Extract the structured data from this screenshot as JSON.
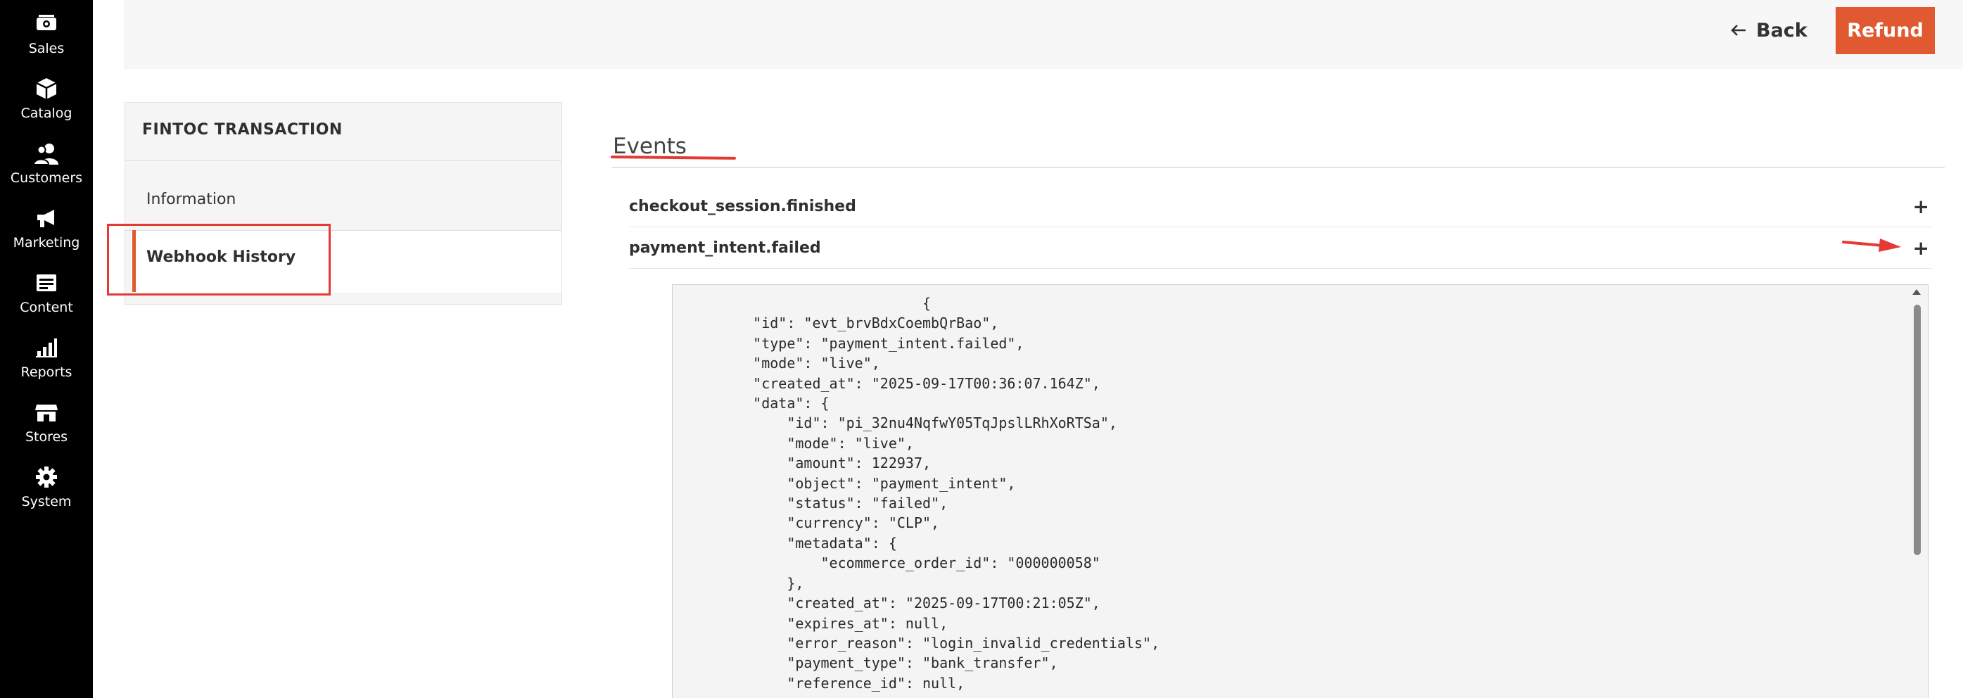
{
  "nav": {
    "items": [
      {
        "label": "Sales",
        "icon": "sales-icon"
      },
      {
        "label": "Catalog",
        "icon": "catalog-icon"
      },
      {
        "label": "Customers",
        "icon": "customers-icon"
      },
      {
        "label": "Marketing",
        "icon": "marketing-icon"
      },
      {
        "label": "Content",
        "icon": "content-icon"
      },
      {
        "label": "Reports",
        "icon": "reports-icon"
      },
      {
        "label": "Stores",
        "icon": "stores-icon"
      },
      {
        "label": "System",
        "icon": "system-icon"
      }
    ]
  },
  "header": {
    "back_label": "Back",
    "refund_label": "Refund",
    "accent_color": "#e15931"
  },
  "panel": {
    "title": "FINTOC TRANSACTION",
    "items": [
      "Information",
      "Webhook History"
    ]
  },
  "events": {
    "title": "Events",
    "rows": [
      {
        "name": "checkout_session.finished",
        "toggle": "+"
      },
      {
        "name": "payment_intent.failed",
        "toggle": "+"
      }
    ],
    "payload": "                        {\n    \"id\": \"evt_brvBdxCoembQrBao\",\n    \"type\": \"payment_intent.failed\",\n    \"mode\": \"live\",\n    \"created_at\": \"2025-09-17T00:36:07.164Z\",\n    \"data\": {\n        \"id\": \"pi_32nu4NqfwY05TqJpslLRhXoRTSa\",\n        \"mode\": \"live\",\n        \"amount\": 122937,\n        \"object\": \"payment_intent\",\n        \"status\": \"failed\",\n        \"currency\": \"CLP\",\n        \"metadata\": {\n            \"ecommerce_order_id\": \"000000058\"\n        },\n        \"created_at\": \"2025-09-17T00:21:05Z\",\n        \"expires_at\": null,\n        \"error_reason\": \"login_invalid_credentials\",\n        \"payment_type\": \"bank_transfer\",\n        \"reference_id\": null,"
  }
}
